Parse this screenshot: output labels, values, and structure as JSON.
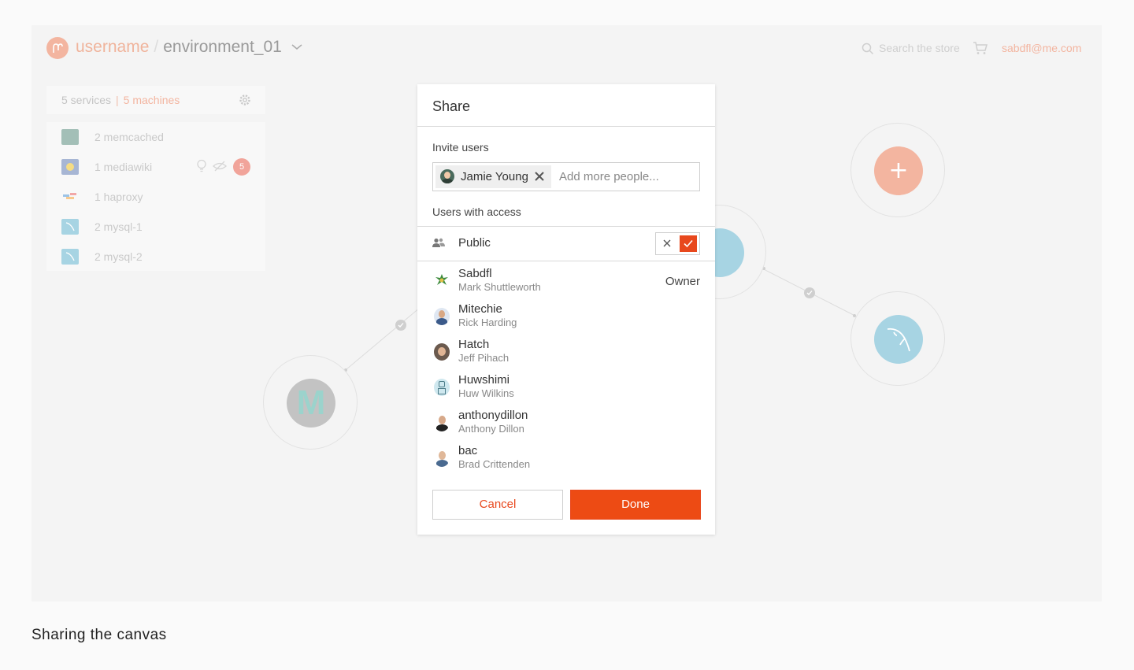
{
  "header": {
    "username": "username",
    "separator": "/",
    "environment": "environment_01",
    "search_placeholder": "Search the store",
    "email": "sabdfl@me.com"
  },
  "services": {
    "services_count": "5 services",
    "machines_count": "5 machines",
    "items": [
      {
        "label": "2 memcached",
        "icon": "memcached-icon",
        "color": "#8fb8b0"
      },
      {
        "label": "1 mediawiki",
        "icon": "mediawiki-icon",
        "color": "#9db1d6",
        "badge": "5"
      },
      {
        "label": "1 haproxy",
        "icon": "haproxy-icon",
        "color": "#e8a4a4"
      },
      {
        "label": "2 mysql-1",
        "icon": "mysql-icon",
        "color": "#a7d4e3"
      },
      {
        "label": "2 mysql-2",
        "icon": "mysql-icon",
        "color": "#a7d4e3"
      }
    ]
  },
  "canvas": {
    "memcached_letter": "M",
    "add_symbol": "+"
  },
  "modal": {
    "title": "Share",
    "invite_label": "Invite users",
    "invited_user": "Jamie Young",
    "invite_placeholder": "Add more people...",
    "access_label": "Users with access",
    "public_label": "Public",
    "users": [
      {
        "username": "Sabdfl",
        "fullname": "Mark Shuttleworth",
        "role": "Owner"
      },
      {
        "username": "Mitechie",
        "fullname": "Rick Harding",
        "role": ""
      },
      {
        "username": "Hatch",
        "fullname": "Jeff Pihach",
        "role": ""
      },
      {
        "username": "Huwshimi",
        "fullname": "Huw Wilkins",
        "role": ""
      },
      {
        "username": "anthonydillon",
        "fullname": "Anthony Dillon",
        "role": ""
      },
      {
        "username": "bac",
        "fullname": "Brad Crittenden",
        "role": ""
      }
    ],
    "cancel_label": "Cancel",
    "done_label": "Done"
  },
  "caption": "Sharing the canvas",
  "colors": {
    "accent": "#e8481d",
    "accent_faded": "#f3b5a0",
    "mysql": "#a7d4e3"
  }
}
